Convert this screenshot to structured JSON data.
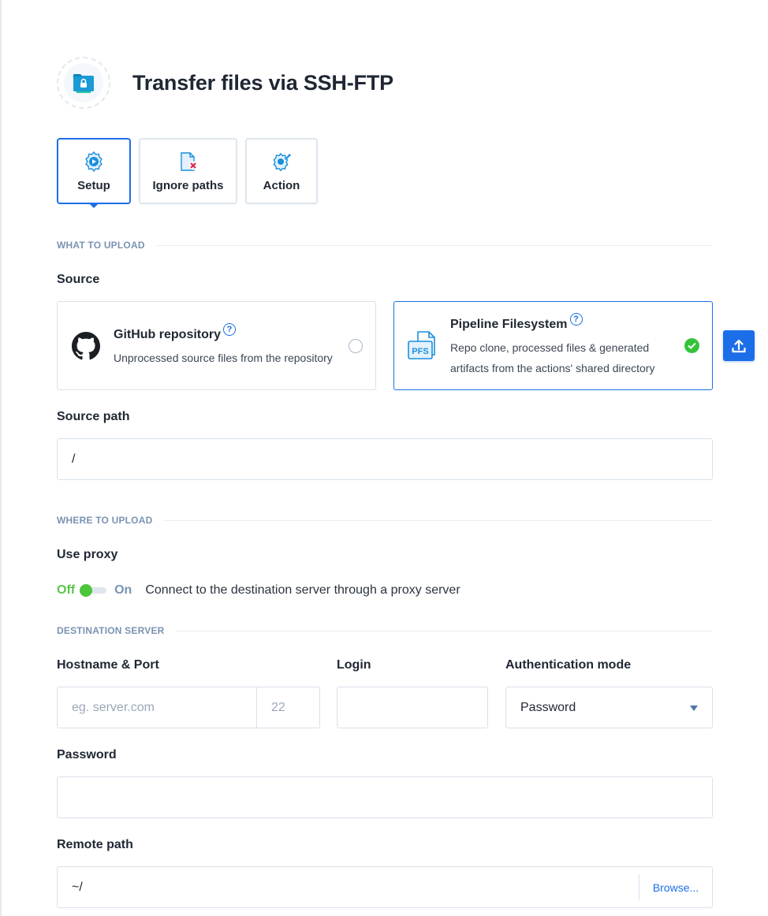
{
  "header": {
    "title": "Transfer files via SSH-FTP",
    "icon": "sftp-folder-lock-icon"
  },
  "tabs": [
    {
      "label": "Setup",
      "icon": "gear-play-icon",
      "active": true
    },
    {
      "label": "Ignore paths",
      "icon": "file-delete-icon",
      "active": false
    },
    {
      "label": "Action",
      "icon": "gear-pen-icon",
      "active": false
    }
  ],
  "what_to_upload": {
    "section_title": "WHAT TO UPLOAD",
    "source_label": "Source",
    "options": [
      {
        "title": "GitHub repository",
        "help": "?",
        "desc": "Unprocessed source files from the repository",
        "icon": "github-icon",
        "selected": false
      },
      {
        "title": "Pipeline Filesystem",
        "help": "?",
        "desc_line1": "Repo clone, processed files & generated",
        "desc_line2": "artifacts from the actions' shared directory",
        "icon_text": "PFS",
        "selected": true
      }
    ],
    "source_path_label": "Source path",
    "source_path_value": "/"
  },
  "where_to_upload": {
    "section_title": "WHERE TO UPLOAD",
    "proxy_label": "Use proxy",
    "toggle_off": "Off",
    "toggle_on": "On",
    "proxy_enabled": false,
    "proxy_desc": "Connect to the destination server through a proxy server"
  },
  "destination": {
    "section_title": "DESTINATION SERVER",
    "host_label": "Hostname & Port",
    "host_placeholder": "eg. server.com",
    "port_placeholder": "22",
    "login_label": "Login",
    "login_value": "",
    "auth_label": "Authentication mode",
    "auth_value": "Password",
    "password_label": "Password",
    "password_value": "",
    "remote_path_label": "Remote path",
    "remote_path_value": "~/",
    "browse_label": "Browse..."
  },
  "colors": {
    "accent": "#1c6ee8",
    "success": "#35c23b",
    "toggle_off": "#5cc74a",
    "section": "#7a93b2"
  }
}
